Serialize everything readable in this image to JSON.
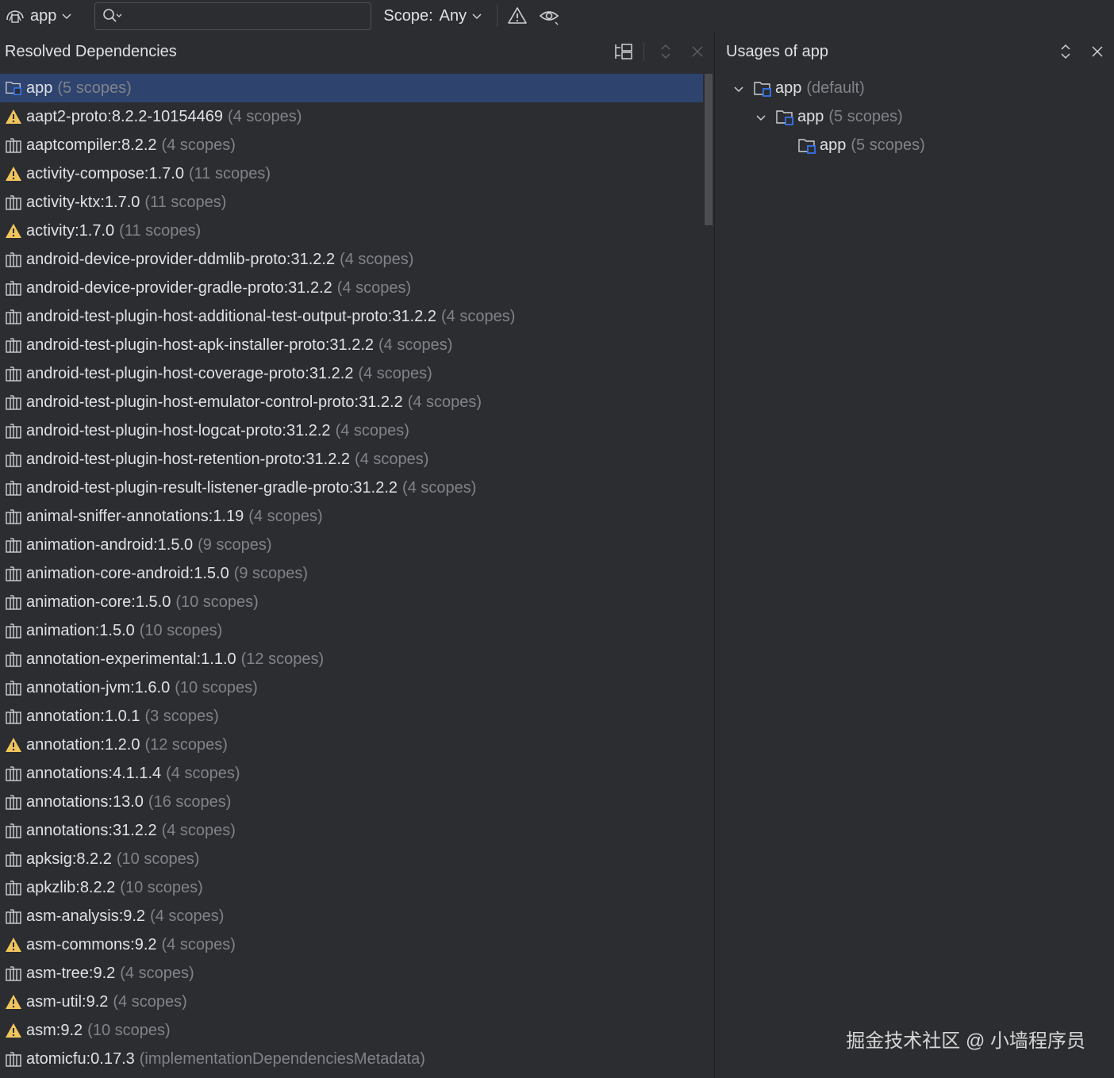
{
  "colors": {
    "background": "#2b2d30",
    "selection": "#2e436e",
    "text": "#dfe1e5",
    "dim_text": "#80838a",
    "warning": "#f2c55c",
    "module_accent": "#3574f0"
  },
  "toolbar": {
    "module_name": "app",
    "search_placeholder": "",
    "search_value": "",
    "scope_label": "Scope:",
    "scope_value": "Any"
  },
  "left_panel": {
    "title": "Resolved Dependencies",
    "rows": [
      {
        "name": "app",
        "scopes": "(5 scopes)",
        "icon": "module-icon",
        "selected": true
      },
      {
        "name": "aapt2-proto:8.2.2-10154469",
        "scopes": "(4 scopes)",
        "icon": "warning-icon"
      },
      {
        "name": "aaptcompiler:8.2.2",
        "scopes": "(4 scopes)",
        "icon": "library-icon"
      },
      {
        "name": "activity-compose:1.7.0",
        "scopes": "(11 scopes)",
        "icon": "warning-icon"
      },
      {
        "name": "activity-ktx:1.7.0",
        "scopes": "(11 scopes)",
        "icon": "library-icon"
      },
      {
        "name": "activity:1.7.0",
        "scopes": "(11 scopes)",
        "icon": "warning-icon"
      },
      {
        "name": "android-device-provider-ddmlib-proto:31.2.2",
        "scopes": "(4 scopes)",
        "icon": "library-icon"
      },
      {
        "name": "android-device-provider-gradle-proto:31.2.2",
        "scopes": "(4 scopes)",
        "icon": "library-icon"
      },
      {
        "name": "android-test-plugin-host-additional-test-output-proto:31.2.2",
        "scopes": "(4 scopes)",
        "icon": "library-icon"
      },
      {
        "name": "android-test-plugin-host-apk-installer-proto:31.2.2",
        "scopes": "(4 scopes)",
        "icon": "library-icon"
      },
      {
        "name": "android-test-plugin-host-coverage-proto:31.2.2",
        "scopes": "(4 scopes)",
        "icon": "library-icon"
      },
      {
        "name": "android-test-plugin-host-emulator-control-proto:31.2.2",
        "scopes": "(4 scopes)",
        "icon": "library-icon"
      },
      {
        "name": "android-test-plugin-host-logcat-proto:31.2.2",
        "scopes": "(4 scopes)",
        "icon": "library-icon"
      },
      {
        "name": "android-test-plugin-host-retention-proto:31.2.2",
        "scopes": "(4 scopes)",
        "icon": "library-icon"
      },
      {
        "name": "android-test-plugin-result-listener-gradle-proto:31.2.2",
        "scopes": "(4 scopes)",
        "icon": "library-icon"
      },
      {
        "name": "animal-sniffer-annotations:1.19",
        "scopes": "(4 scopes)",
        "icon": "library-icon"
      },
      {
        "name": "animation-android:1.5.0",
        "scopes": "(9 scopes)",
        "icon": "library-icon"
      },
      {
        "name": "animation-core-android:1.5.0",
        "scopes": "(9 scopes)",
        "icon": "library-icon"
      },
      {
        "name": "animation-core:1.5.0",
        "scopes": "(10 scopes)",
        "icon": "library-icon"
      },
      {
        "name": "animation:1.5.0",
        "scopes": "(10 scopes)",
        "icon": "library-icon"
      },
      {
        "name": "annotation-experimental:1.1.0",
        "scopes": "(12 scopes)",
        "icon": "library-icon"
      },
      {
        "name": "annotation-jvm:1.6.0",
        "scopes": "(10 scopes)",
        "icon": "library-icon"
      },
      {
        "name": "annotation:1.0.1",
        "scopes": "(3 scopes)",
        "icon": "library-icon"
      },
      {
        "name": "annotation:1.2.0",
        "scopes": "(12 scopes)",
        "icon": "warning-icon"
      },
      {
        "name": "annotations:4.1.1.4",
        "scopes": "(4 scopes)",
        "icon": "library-icon"
      },
      {
        "name": "annotations:13.0",
        "scopes": "(16 scopes)",
        "icon": "library-icon"
      },
      {
        "name": "annotations:31.2.2",
        "scopes": "(4 scopes)",
        "icon": "library-icon"
      },
      {
        "name": "apksig:8.2.2",
        "scopes": "(10 scopes)",
        "icon": "library-icon"
      },
      {
        "name": "apkzlib:8.2.2",
        "scopes": "(10 scopes)",
        "icon": "library-icon"
      },
      {
        "name": "asm-analysis:9.2",
        "scopes": "(4 scopes)",
        "icon": "library-icon"
      },
      {
        "name": "asm-commons:9.2",
        "scopes": "(4 scopes)",
        "icon": "warning-icon"
      },
      {
        "name": "asm-tree:9.2",
        "scopes": "(4 scopes)",
        "icon": "library-icon"
      },
      {
        "name": "asm-util:9.2",
        "scopes": "(4 scopes)",
        "icon": "warning-icon"
      },
      {
        "name": "asm:9.2",
        "scopes": "(10 scopes)",
        "icon": "warning-icon"
      },
      {
        "name": "atomicfu:0.17.3",
        "scopes": "(implementationDependenciesMetadata)",
        "icon": "library-icon"
      }
    ]
  },
  "right_panel": {
    "title": "Usages of app",
    "rows": [
      {
        "name": "app",
        "scopes": "(default)",
        "level": 0,
        "expanded": true
      },
      {
        "name": "app",
        "scopes": "(5 scopes)",
        "level": 1,
        "expanded": true
      },
      {
        "name": "app",
        "scopes": "(5 scopes)",
        "level": 2,
        "expanded": false
      }
    ]
  },
  "watermark": "掘金技术社区 @ 小墙程序员"
}
